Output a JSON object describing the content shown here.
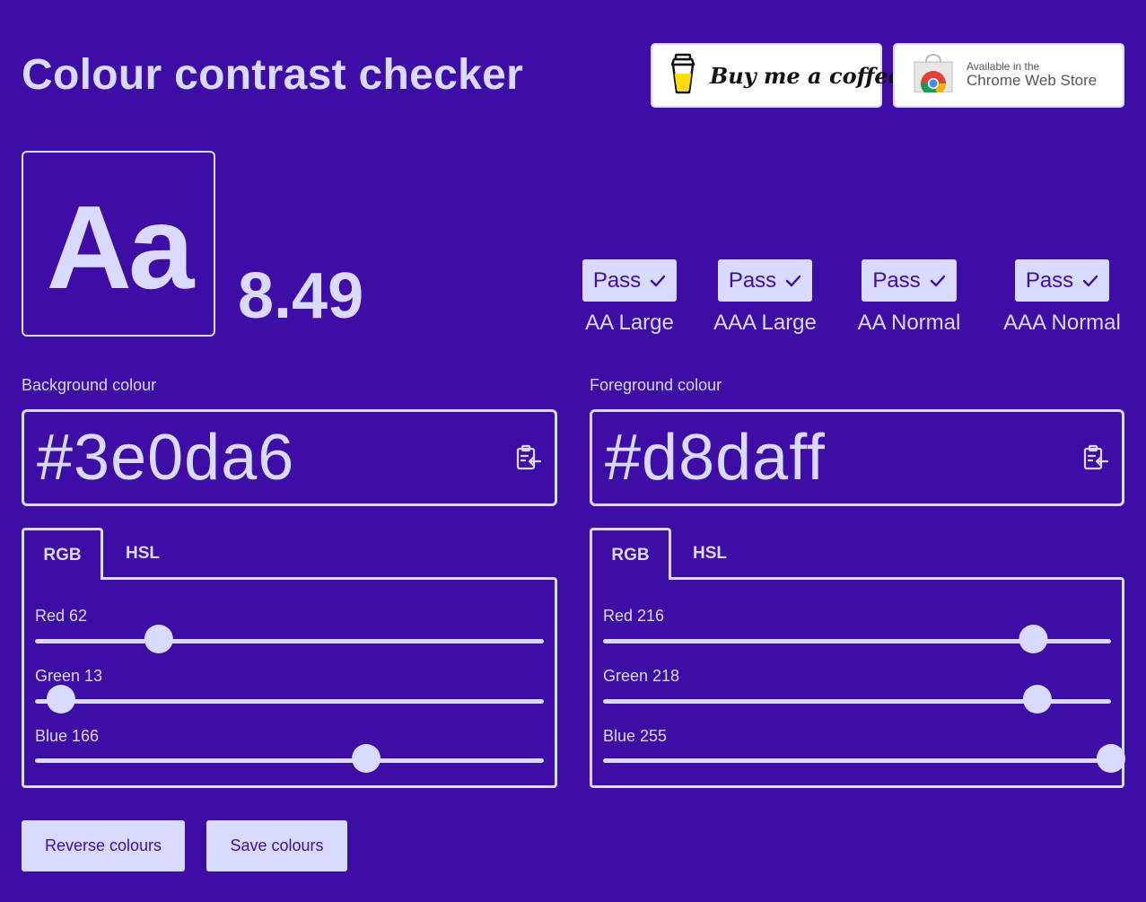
{
  "header": {
    "title": "Colour contrast checker",
    "coffee_label": "Buy me a coffee",
    "chrome_small": "Available in the",
    "chrome_big": "Chrome Web Store"
  },
  "preview": {
    "sample_text": "Aa",
    "ratio": "8.49"
  },
  "results": [
    {
      "status": "Pass",
      "label": "AA Large"
    },
    {
      "status": "Pass",
      "label": "AAA Large"
    },
    {
      "status": "Pass",
      "label": "AA Normal"
    },
    {
      "status": "Pass",
      "label": "AAA Normal"
    }
  ],
  "background": {
    "label": "Background colour",
    "value": "#3e0da6",
    "tabs": [
      "RGB",
      "HSL"
    ],
    "active_tab": "RGB",
    "sliders": [
      {
        "label": "Red 62",
        "name": "Red",
        "value": 62,
        "max": 255
      },
      {
        "label": "Green 13",
        "name": "Green",
        "value": 13,
        "max": 255
      },
      {
        "label": "Blue 166",
        "name": "Blue",
        "value": 166,
        "max": 255
      }
    ]
  },
  "foreground": {
    "label": "Foreground colour",
    "value": "#d8daff",
    "tabs": [
      "RGB",
      "HSL"
    ],
    "active_tab": "RGB",
    "sliders": [
      {
        "label": "Red 216",
        "name": "Red",
        "value": 216,
        "max": 255
      },
      {
        "label": "Green 218",
        "name": "Green",
        "value": 218,
        "max": 255
      },
      {
        "label": "Blue 255",
        "name": "Blue",
        "value": 255,
        "max": 255
      }
    ]
  },
  "actions": {
    "reverse_label": "Reverse colours",
    "save_label": "Save colours"
  },
  "colors": {
    "background": "#3e0da6",
    "foreground": "#d8daff"
  },
  "icons": [
    "coffee-cup-icon",
    "chrome-store-icon",
    "check-icon",
    "paste-clipboard-icon"
  ]
}
